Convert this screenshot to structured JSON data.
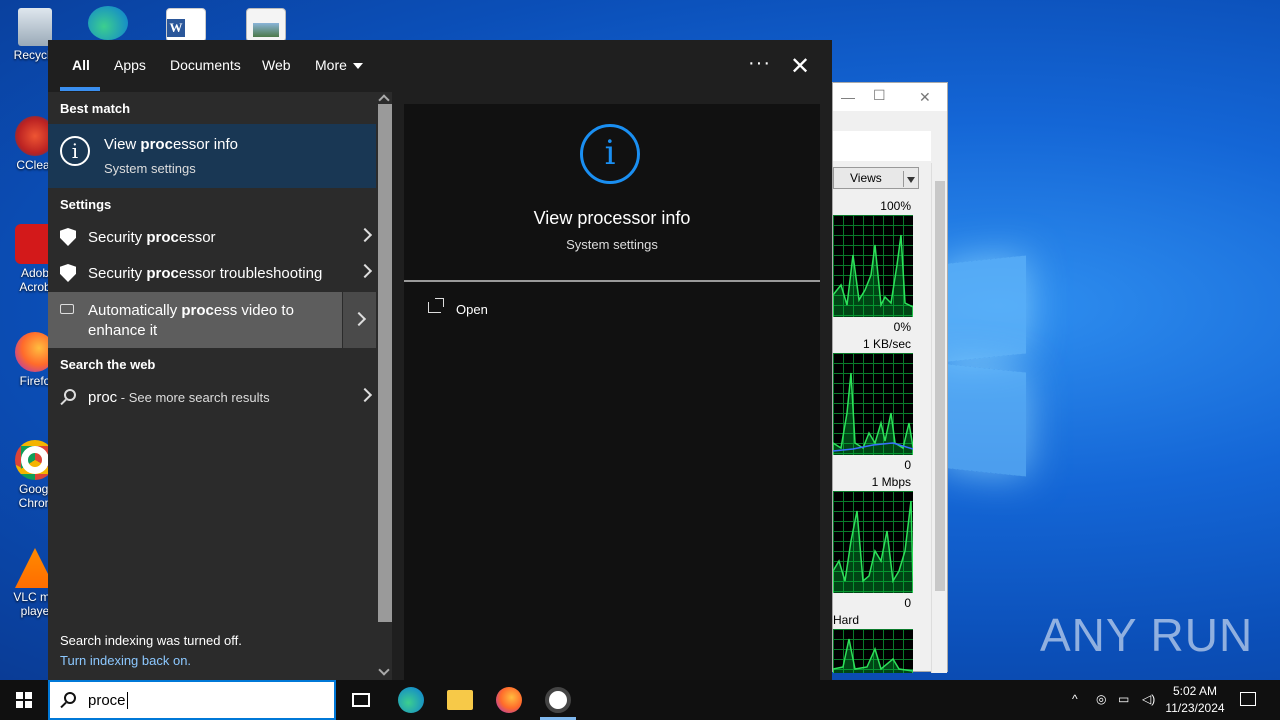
{
  "desktop": {
    "icons": [
      {
        "label": "Recycle",
        "icon": "recycle-bin-icon"
      },
      {
        "label": "CClear",
        "icon": "ccleaner-icon"
      },
      {
        "label": "Adob Acrob",
        "icon": "acrobat-icon"
      },
      {
        "label": "Firefo",
        "icon": "firefox-icon"
      },
      {
        "label": "Googl Chron",
        "icon": "chrome-icon"
      },
      {
        "label": "VLC me playe",
        "icon": "vlc-icon"
      }
    ],
    "watermark": "ANY RUN"
  },
  "background_window": {
    "views_label": "Views",
    "graphs": [
      {
        "top_label": "100%",
        "bottom_label": "0%"
      },
      {
        "top_label": "1 KB/sec",
        "bottom_label": "0"
      },
      {
        "top_label": "1 Mbps",
        "bottom_label": "0"
      },
      {
        "top_label": "Hard Faults/sec",
        "bottom_label": ""
      }
    ]
  },
  "search_panel": {
    "tabs": [
      "All",
      "Apps",
      "Documents",
      "Web",
      "More"
    ],
    "active_tab": "All",
    "more_icon": "chevron-down-icon",
    "options_label": "···",
    "close_label": "✕",
    "best_match_header": "Best match",
    "best_match": {
      "title_pre": "View ",
      "title_bold": "proc",
      "title_post": "essor info",
      "subtitle": "System settings"
    },
    "settings_header": "Settings",
    "settings_items": [
      {
        "pre": "Security ",
        "bold": "proc",
        "post": "essor",
        "icon": "shield-icon"
      },
      {
        "pre": "Security ",
        "bold": "proc",
        "post": "essor troubleshooting",
        "icon": "shield-icon"
      },
      {
        "pre": "Automatically ",
        "bold": "proc",
        "post": "ess video to enhance it",
        "icon": "video-camera-icon"
      }
    ],
    "web_header": "Search the web",
    "web_item": {
      "query": "proc",
      "suffix": " - See more search results"
    },
    "index_note": "Search indexing was turned off.",
    "index_link": "Turn indexing back on.",
    "detail": {
      "title": "View processor info",
      "subtitle": "System settings",
      "open_label": "Open"
    }
  },
  "taskbar": {
    "search_value": "proce",
    "clock_time": "5:02 AM",
    "clock_date": "11/23/2024",
    "pinned": [
      "task-view-icon",
      "edge-icon",
      "file-explorer-icon",
      "firefox-icon",
      "unknown-app-icon"
    ]
  },
  "colors": {
    "accent": "#1a8ff2",
    "best_match_bg": "#193754",
    "link": "#8cc8ff"
  }
}
